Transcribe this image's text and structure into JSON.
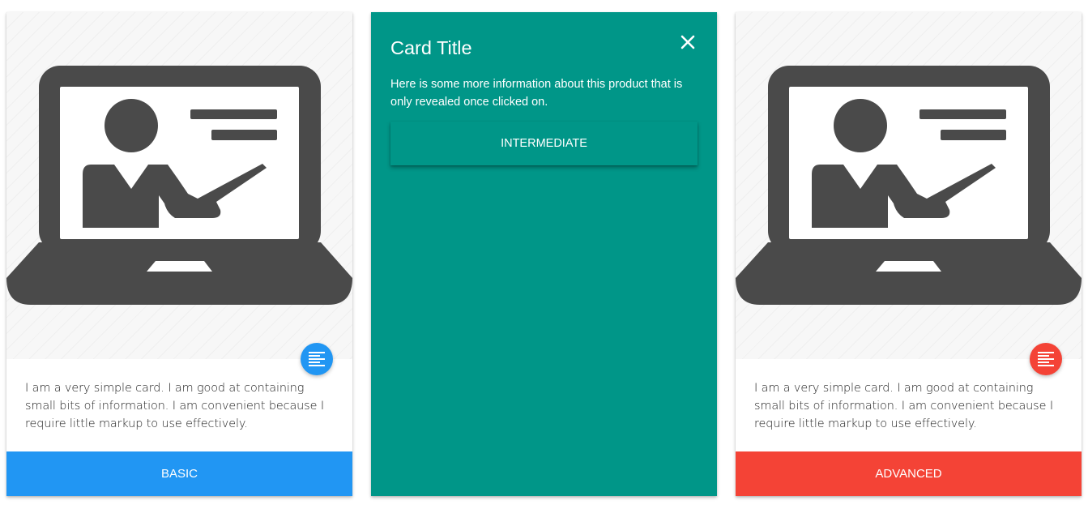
{
  "colors": {
    "basic": "#2196F3",
    "intermediate": "#009688",
    "advanced": "#F44336",
    "icon_dark": "#4a4a4a"
  },
  "cards": [
    {
      "image_icon": "laptop-presenter-icon",
      "fab_icon": "text-lines-icon",
      "content": "I am a very simple card. I am good at containing small bits of information. I am convenient because I require little markup to use effectively.",
      "action_label": "BASIC"
    },
    {
      "reveal_title": "Card Title",
      "close_icon": "close-icon",
      "reveal_text": "Here is some more information about this product that is only revealed once clicked on.",
      "action_label": "INTERMEDIATE"
    },
    {
      "image_icon": "laptop-presenter-icon",
      "fab_icon": "text-lines-icon",
      "content": "I am a very simple card. I am good at containing small bits of information. I am convenient because I require little markup to use effectively.",
      "action_label": "ADVANCED"
    }
  ]
}
